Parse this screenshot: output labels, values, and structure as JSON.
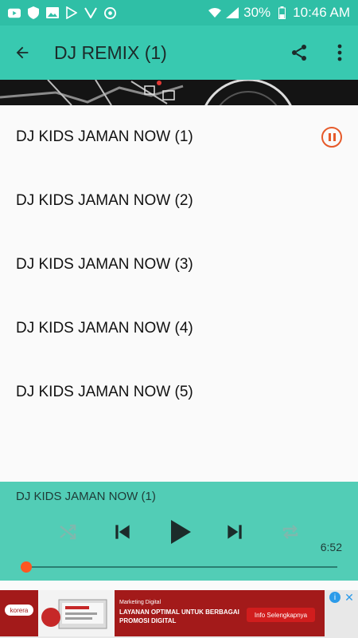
{
  "status_bar": {
    "battery": "30%",
    "time": "10:46 AM",
    "icons": [
      "youtube-icon",
      "shield-icon",
      "image-icon",
      "play-store-icon",
      "vidmate-icon",
      "chrome-icon",
      "wifi-icon",
      "signal-icon",
      "battery-icon"
    ]
  },
  "toolbar": {
    "title": "DJ REMIX (1)",
    "back_icon": "arrow-back-icon",
    "share_icon": "share-icon",
    "menu_icon": "more-vert-icon"
  },
  "tracks": [
    {
      "title": "DJ KIDS JAMAN NOW (1)",
      "playing": true
    },
    {
      "title": "DJ KIDS JAMAN NOW (2)",
      "playing": false
    },
    {
      "title": "DJ KIDS JAMAN NOW (3)",
      "playing": false
    },
    {
      "title": "DJ KIDS JAMAN NOW (4)",
      "playing": false
    },
    {
      "title": "DJ KIDS JAMAN NOW (5)",
      "playing": false
    }
  ],
  "player": {
    "now_playing": "DJ KIDS JAMAN NOW (1)",
    "duration": "6:52",
    "progress": 0.0
  },
  "ad": {
    "brand": "korera",
    "kicker": "Marketing Digital",
    "headline": "LAYANAN OPTIMAL UNTUK BERBAGAI PROMOSI DIGITAL",
    "cta": "Info Selengkapnya",
    "info": "i",
    "close": "✕"
  },
  "colors": {
    "accent": "#38c9b0",
    "status_bar": "#2fbfa6",
    "player_bg": "#52cdb6",
    "pause": "#e65a2a",
    "knob": "#ff5722"
  }
}
